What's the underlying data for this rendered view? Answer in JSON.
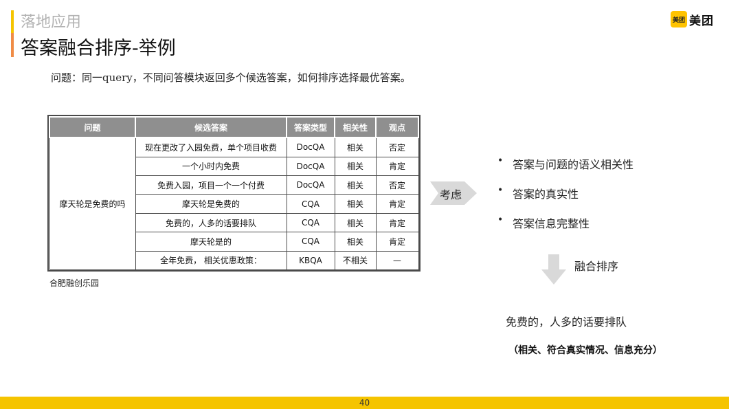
{
  "header": {
    "section": "落地应用",
    "title": "答案融合排序-举例"
  },
  "logo": {
    "icon_text": "美团",
    "text": "美团"
  },
  "question": "问题：同一query，不同问答模块返回多个候选答案，如何排序选择最优答案。",
  "table": {
    "headers": [
      "问题",
      "候选答案",
      "答案类型",
      "相关性",
      "观点"
    ],
    "question_cell": "摩天轮是免费的吗",
    "rows": [
      {
        "answer": "现在更改了入园免费，单个项目收费",
        "type": "DocQA",
        "relevance": "相关",
        "view": "否定"
      },
      {
        "answer": "一个小时内免费",
        "type": "DocQA",
        "relevance": "相关",
        "view": "肯定"
      },
      {
        "answer": "免费入园，项目一个一个付费",
        "type": "DocQA",
        "relevance": "相关",
        "view": "否定"
      },
      {
        "answer": "摩天轮是免费的",
        "type": "CQA",
        "relevance": "相关",
        "view": "肯定"
      },
      {
        "answer": "免费的，人多的话要排队",
        "type": "CQA",
        "relevance": "相关",
        "view": "肯定"
      },
      {
        "answer": "摩天轮是的",
        "type": "CQA",
        "relevance": "相关",
        "view": "肯定"
      },
      {
        "answer": "全年免费， 相关优惠政策：",
        "type": "KBQA",
        "relevance": "不相关",
        "view": "—"
      }
    ],
    "caption": "合肥融创乐园"
  },
  "consider_label": "考虑",
  "factors": [
    "答案与问题的语义相关性",
    "答案的真实性",
    "答案信息完整性"
  ],
  "merge_label": "融合排序",
  "final_answer": "免费的，人多的话要排队",
  "final_reason": "（相关、符合真实情况、信息充分）",
  "page_number": "40",
  "colors": {
    "accent_yellow": "#f5c400",
    "accent_orange": "#f08c46",
    "table_header": "#8f8f8f"
  }
}
